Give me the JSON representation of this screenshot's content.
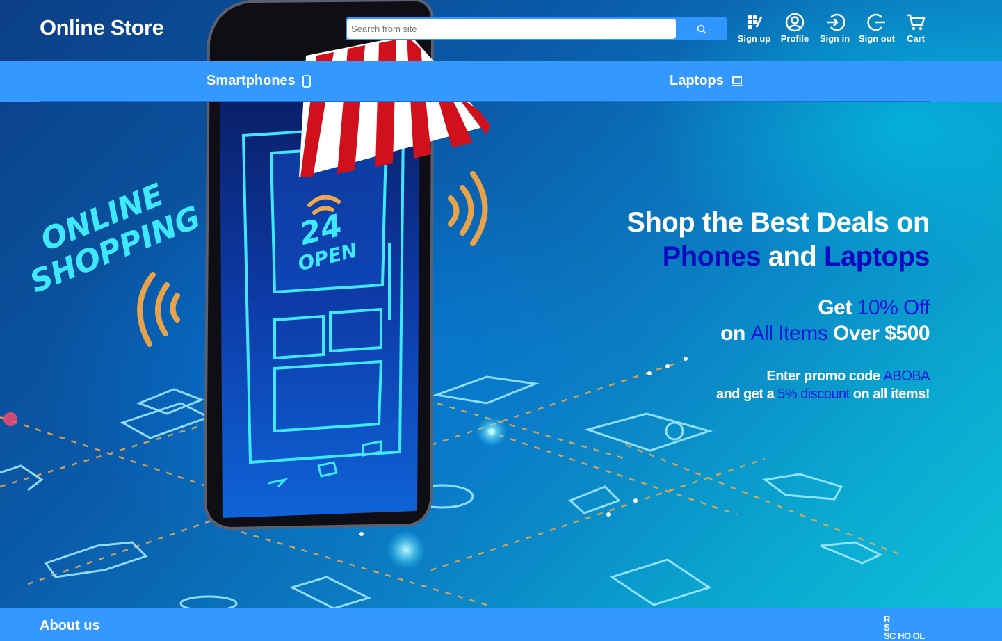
{
  "header": {
    "logo": "Online Store",
    "search_placeholder": "Search from site",
    "actions": [
      {
        "label": "Sign up",
        "icon": "sign-up-icon"
      },
      {
        "label": "Profile",
        "icon": "profile-icon"
      },
      {
        "label": "Sign in",
        "icon": "sign-in-icon"
      },
      {
        "label": "Sign out",
        "icon": "sign-out-icon"
      },
      {
        "label": "Cart",
        "icon": "cart-icon"
      }
    ]
  },
  "categories": [
    {
      "label": "Smartphones",
      "icon": "smartphone-icon"
    },
    {
      "label": "Laptops",
      "icon": "laptop-icon"
    }
  ],
  "hero": {
    "banner_text_line1": "ONLINE",
    "banner_text_line2": "SHOPPING",
    "phone_sign_number": "24",
    "phone_sign_word": "OPEN",
    "headline_line1": "Shop the Best Deals on",
    "headline_phones": "Phones",
    "headline_and": "and",
    "headline_laptops": "Laptops",
    "offer_get": "Get",
    "offer_discount": "10% Off",
    "offer_on": "on",
    "offer_items": "All Items",
    "offer_over": "Over $500",
    "promo_enter": "Enter promo code",
    "promo_code": "ABOBA",
    "promo_and_get": "and get a",
    "promo_discount": "5% discount",
    "promo_on_all": "on all items!"
  },
  "footer": {
    "about_label": "About us",
    "school_logo_top": "R S",
    "school_logo_bottom": "SC HO OL"
  },
  "colors": {
    "primary_blue": "#3399ff",
    "accent_blue": "#0a0ac0",
    "text_white": "#ffffff"
  }
}
